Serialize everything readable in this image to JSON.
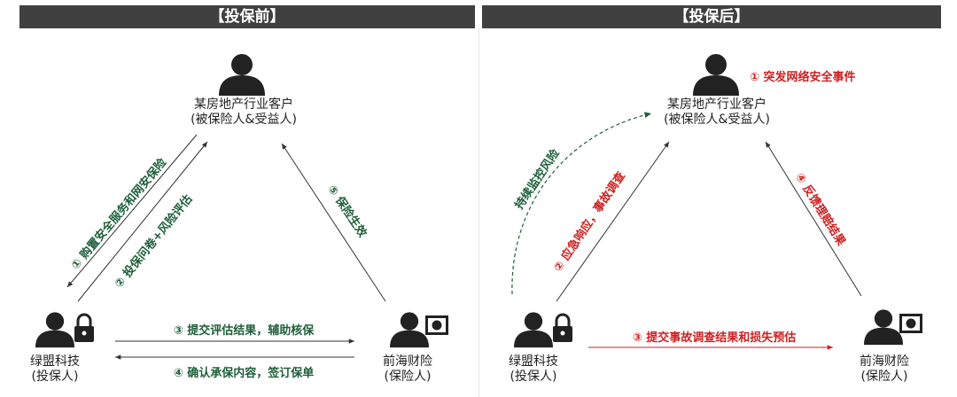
{
  "colors": {
    "header_bg": "#404040",
    "green": "#1e5e3a",
    "red": "#cc1f1f",
    "icon": "#222222"
  },
  "left_panel": {
    "title": "【投保前】",
    "customer": {
      "line1": "某房地产行业客户",
      "line2": "(被保险人&受益人)"
    },
    "tech": {
      "line1": "绿盟科技",
      "line2": "(投保人)"
    },
    "insurer": {
      "line1": "前海财险",
      "line2": "(保险人)"
    },
    "steps": {
      "s1": "① 购置安全服务和网安保险",
      "s2": "② 投保问卷+风险评估",
      "s3": "③ 提交评估结果，辅助核保",
      "s4": "④ 确认承保内容，签订保单",
      "s5": "⑤ 保险生效"
    }
  },
  "right_panel": {
    "title": "【投保后】",
    "event": "① 突发网络安全事件",
    "customer": {
      "line1": "某房地产行业客户",
      "line2": "(被保险人&受益人)"
    },
    "tech": {
      "line1": "绿盟科技",
      "line2": "(投保人)"
    },
    "insurer": {
      "line1": "前海财险",
      "line2": "(保险人)"
    },
    "steps": {
      "monitor": "持续监控风险",
      "s2": "② 应急响应，事故调查",
      "s3": "③ 提交事故调查结果和损失预估",
      "s4": "④ 反馈理赔结果"
    }
  },
  "icons": {
    "person": "person-icon",
    "lock": "lock-icon",
    "money": "money-icon"
  }
}
